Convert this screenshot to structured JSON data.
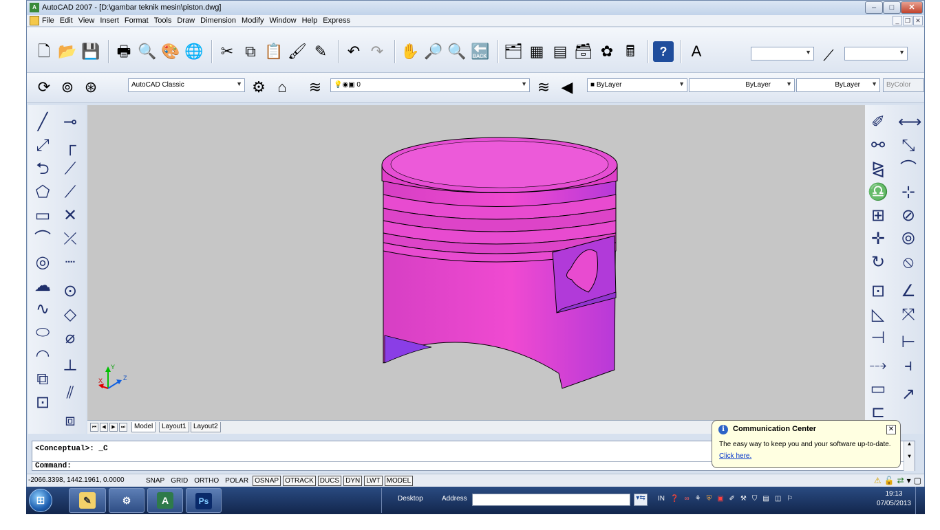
{
  "window": {
    "title": "AutoCAD 2007 - [D:\\gambar teknik mesin\\piston.dwg]",
    "app_icon": "autocad-logo-icon"
  },
  "menu": [
    "File",
    "Edit",
    "View",
    "Insert",
    "Format",
    "Tools",
    "Draw",
    "Dimension",
    "Modify",
    "Window",
    "Help",
    "Express"
  ],
  "toolbar": {
    "workspace": "AutoCAD Classic",
    "layer": "0",
    "color": "ByLayer",
    "linetype": "ByLayer",
    "lineweight": "ByLayer",
    "plotstyle": "ByColor",
    "text_style": "",
    "dim_style": ""
  },
  "tabs": [
    "Model",
    "Layout1",
    "Layout2"
  ],
  "command": {
    "history": "<Conceptual>: _C",
    "prompt": "Command:"
  },
  "status": {
    "coordinates": "-2066.3398, 1442.1961, 0.0000",
    "buttons": [
      {
        "label": "SNAP",
        "on": false
      },
      {
        "label": "GRID",
        "on": false
      },
      {
        "label": "ORTHO",
        "on": false
      },
      {
        "label": "POLAR",
        "on": false
      },
      {
        "label": "OSNAP",
        "on": true
      },
      {
        "label": "OTRACK",
        "on": true
      },
      {
        "label": "DUCS",
        "on": true
      },
      {
        "label": "DYN",
        "on": true
      },
      {
        "label": "LWT",
        "on": true
      },
      {
        "label": "MODEL",
        "on": true
      }
    ]
  },
  "comm_center": {
    "title": "Communication Center",
    "text": "The easy way to keep you and your software up-to-date.",
    "link": "Click here."
  },
  "ucs": {
    "x": "X",
    "y": "Y",
    "z": "Z"
  },
  "taskbar": {
    "desktop": "Desktop",
    "address_label": "Address",
    "address_value": "",
    "tray_text": "IN",
    "time": "19:13",
    "date": "07/05/2013",
    "apps": [
      "paint-icon",
      "settings-icon",
      "autocad-icon",
      "photoshop-icon"
    ],
    "ps_label": "Ps"
  },
  "colors": {
    "piston_main": "#e645c8",
    "piston_shade": "#b033d9",
    "viewport_bg": "#c6c6c6"
  }
}
